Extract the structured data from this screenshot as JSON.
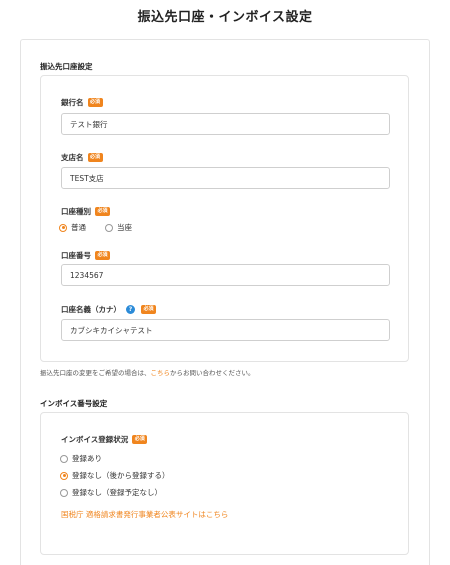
{
  "page": {
    "title": "振込先口座・インボイス設定"
  },
  "bank_section": {
    "title": "振込先口座設定",
    "required_label": "必須",
    "bank_name": {
      "label": "銀行名",
      "value": "テスト銀行"
    },
    "branch_name": {
      "label": "支店名",
      "value": "TEST支店"
    },
    "account_type": {
      "label": "口座種別",
      "options": [
        "普通",
        "当座"
      ],
      "selected": "普通"
    },
    "account_number": {
      "label": "口座番号",
      "value": "1234567"
    },
    "account_holder": {
      "label": "口座名義（カナ）",
      "help_icon": "?",
      "value": "カブシキカイシャテスト"
    },
    "note": {
      "before": "振込先口座の変更をご希望の場合は、",
      "link": "こちら",
      "after": "からお問い合わせください。"
    }
  },
  "invoice_section": {
    "title": "インボイス番号設定",
    "status_label": "インボイス登録状況",
    "required_label": "必須",
    "options": [
      "登録あり",
      "登録なし（後から登録する）",
      "登録なし（登録予定なし）"
    ],
    "selected": "登録なし（後から登録する）",
    "link": "国税庁 適格請求書発行事業者公表サイトはこちら"
  },
  "colors": {
    "accent": "#f0851e",
    "help": "#2b8bd8",
    "border": "#e3e3e3"
  }
}
